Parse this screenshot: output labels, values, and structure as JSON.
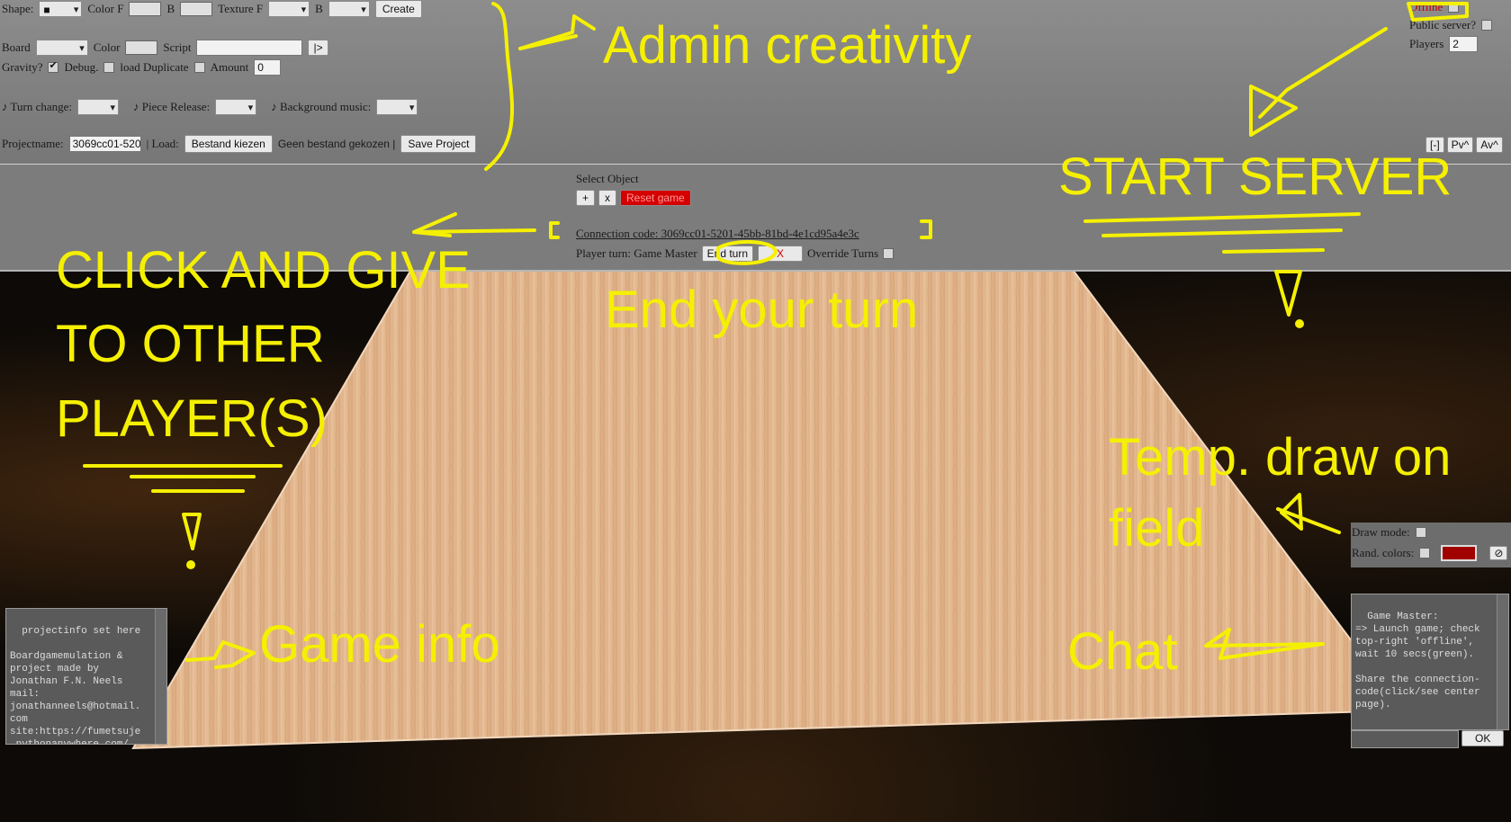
{
  "top_row1": {
    "shape_label": "Shape:",
    "shape_value": "■",
    "color_f_label": "Color F",
    "b_label": "B",
    "texture_label": "Texture F",
    "b2_label": "B",
    "create_label": "Create"
  },
  "top_row2": {
    "board_label": "Board",
    "color_label": "Color",
    "script_label": "Script",
    "run_label": "|>"
  },
  "top_row3": {
    "gravity_label": "Gravity?",
    "debug_label": "Debug.",
    "load_dup_label": "load Duplicate",
    "amount_label": "Amount",
    "amount_value": "0"
  },
  "top_row4": {
    "turn_change_label": "♪ Turn change:",
    "piece_release_label": "♪ Piece Release:",
    "bg_music_label": "♪ Background music:"
  },
  "top_row5": {
    "projectname_label": "Projectname:",
    "projectname_value": "3069cc01-520",
    "load_label": "| Load:",
    "choose_file_label": "Bestand kiezen",
    "no_file_label": "Geen bestand gekozen |",
    "save_label": "Save Project"
  },
  "right_top": {
    "offline_label": "Offline",
    "public_server_label": "Public server?",
    "players_label": "Players",
    "players_value": "2",
    "btn1": "[-]",
    "btn2": "Pv^",
    "btn3": "Av^"
  },
  "center": {
    "select_object_label": "Select Object",
    "add_label": "+",
    "x_label": "x",
    "reset_label": "Reset game",
    "connection_label": "Connection code: 3069cc01-5201-45bb-81bd-4e1cd95a4e3c",
    "player_turn_label": "Player turn: Game Master",
    "end_turn_label": "End turn",
    "x_red_label": "X",
    "override_label": "Override Turns"
  },
  "draw": {
    "draw_mode_label": "Draw mode:",
    "rand_colors_label": "Rand. colors:",
    "clear_label": "⊘"
  },
  "info_text": "projectinfo set here\n\nBoardgamemulation &\nproject made by\nJonathan F.N. Neels\nmail:\njonathanneels@hotmail.\ncom\nsite:https://fumetsuje\n.pythonanywhere.com/",
  "chat_text": "Game Master:\n=> Launch game; check\ntop-right 'offline',\nwait 10 secs(green).\n\nShare the connection-\ncode(click/see center\npage).",
  "chat_ok": "OK",
  "annotations": {
    "admin": "Admin creativity",
    "start_server": "START SERVER",
    "click_give": "CLICK AND GIVE\nTO OTHER\nPLAYER(S)",
    "end_turn": "End your turn",
    "temp_draw": "Temp. draw on\nfield",
    "game_info": "Game info",
    "chat": "Chat"
  },
  "colors": {
    "annotation": "#f5f000",
    "reset_btn": "#d40000",
    "draw_color": "#a00000"
  }
}
